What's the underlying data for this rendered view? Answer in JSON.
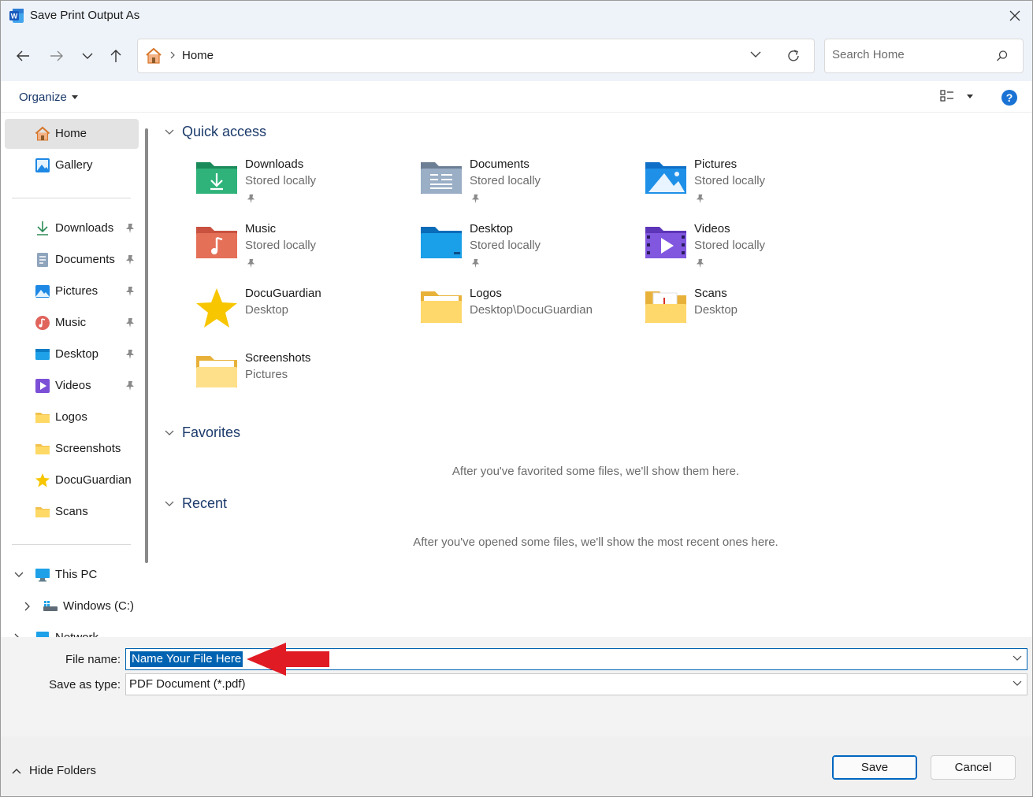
{
  "window": {
    "title": "Save Print Output As",
    "app_icon": "word-icon"
  },
  "nav": {
    "back": "back-arrow-icon",
    "forward": "forward-arrow-icon",
    "recent": "chevron-down-icon",
    "up": "up-arrow-icon",
    "breadcrumb": "Home",
    "search_placeholder": "Search Home"
  },
  "toolbar": {
    "organize": "Organize"
  },
  "sidebar": {
    "top": [
      {
        "label": "Home",
        "icon": "home-icon"
      },
      {
        "label": "Gallery",
        "icon": "gallery-icon"
      }
    ],
    "pinned": [
      {
        "label": "Downloads"
      },
      {
        "label": "Documents"
      },
      {
        "label": "Pictures"
      },
      {
        "label": "Music"
      },
      {
        "label": "Desktop"
      },
      {
        "label": "Videos"
      },
      {
        "label": "Logos"
      },
      {
        "label": "Screenshots"
      },
      {
        "label": "DocuGuardian"
      },
      {
        "label": "Scans"
      }
    ],
    "this_pc": "This PC",
    "windows_c": "Windows (C:)",
    "network": "Network"
  },
  "main": {
    "quick_access": {
      "header": "Quick access",
      "items": [
        {
          "name": "Downloads",
          "sub": "Stored locally"
        },
        {
          "name": "Documents",
          "sub": "Stored locally"
        },
        {
          "name": "Pictures",
          "sub": "Stored locally"
        },
        {
          "name": "Music",
          "sub": "Stored locally"
        },
        {
          "name": "Desktop",
          "sub": "Stored locally"
        },
        {
          "name": "Videos",
          "sub": "Stored locally"
        },
        {
          "name": "DocuGuardian",
          "sub": "Desktop"
        },
        {
          "name": "Logos",
          "sub": "Desktop\\DocuGuardian"
        },
        {
          "name": "Scans",
          "sub": "Desktop"
        },
        {
          "name": "Screenshots",
          "sub": "Pictures"
        }
      ]
    },
    "favorites": {
      "header": "Favorites",
      "empty": "After you've favorited some files, we'll show them here."
    },
    "recent": {
      "header": "Recent",
      "empty": "After you've opened some files, we'll show the most recent ones here."
    }
  },
  "form": {
    "file_name_label": "File name:",
    "file_name_value": "Name Your File Here",
    "save_type_label": "Save as type:",
    "save_type_value": "PDF Document (*.pdf)"
  },
  "footer": {
    "hide_folders": "Hide Folders",
    "save": "Save",
    "cancel": "Cancel"
  },
  "colors": {
    "accent": "#0063b1",
    "header_text": "#1b3a6b",
    "annotation_arrow": "#e01b24"
  }
}
